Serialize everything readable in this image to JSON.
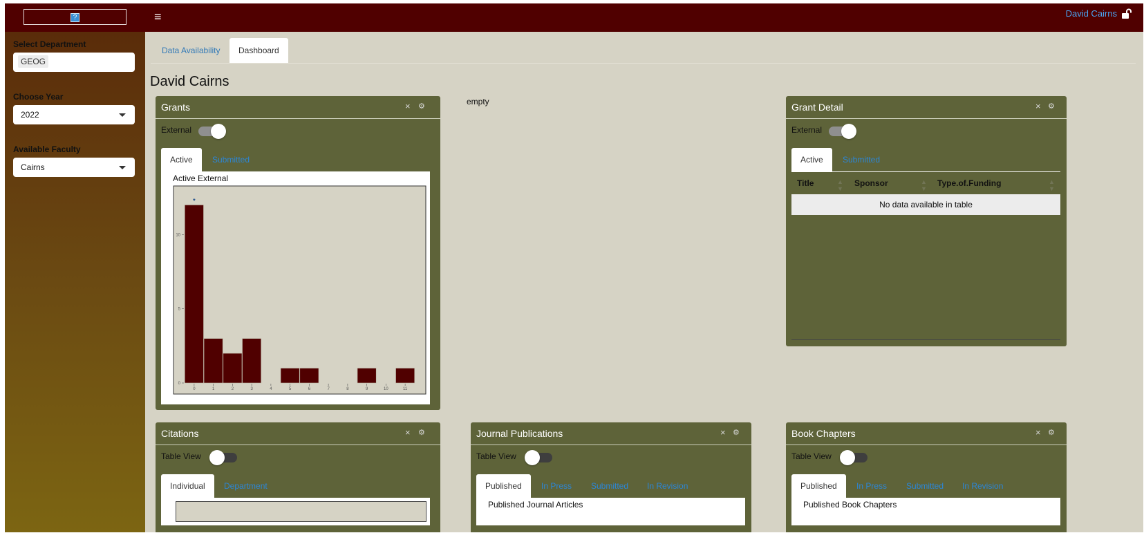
{
  "header": {
    "logo_icon": "?",
    "menu_icon": "≡",
    "user_name": "David Cairns",
    "lock_icon": "unlock-icon"
  },
  "sidebar": {
    "department_label": "Select Department",
    "department_value": "GEOG",
    "year_label": "Choose Year",
    "year_value": "2022",
    "faculty_label": "Available Faculty",
    "faculty_value": "Cairns"
  },
  "main_tabs": [
    {
      "label": "Data Availability",
      "active": false
    },
    {
      "label": "Dashboard",
      "active": true
    }
  ],
  "page_title": "David Cairns",
  "empty_text": "empty",
  "grants": {
    "title": "Grants",
    "toggle_label": "External",
    "toggle_on": true,
    "tabs": [
      "Active",
      "Submitted"
    ],
    "panel_caption": "Active External"
  },
  "grant_detail": {
    "title": "Grant Detail",
    "toggle_label": "External",
    "toggle_on": true,
    "tabs": [
      "Active",
      "Submitted"
    ],
    "columns": [
      "Title",
      "Sponsor",
      "Type.of.Funding"
    ],
    "no_data": "No data available in table"
  },
  "citations": {
    "title": "Citations",
    "toggle_label": "Table View",
    "toggle_on": false,
    "tabs": [
      "Individual",
      "Department"
    ],
    "panel_caption": ""
  },
  "journal_publications": {
    "title": "Journal Publications",
    "toggle_label": "Table View",
    "toggle_on": false,
    "tabs": [
      "Published",
      "In Press",
      "Submitted",
      "In Revision"
    ],
    "panel_caption": "Published Journal Articles"
  },
  "book_chapters": {
    "title": "Book Chapters",
    "toggle_label": "Table View",
    "toggle_on": false,
    "tabs": [
      "Published",
      "In Press",
      "Submitted",
      "In Revision"
    ],
    "panel_caption": "Published Book Chapters"
  },
  "box_controls": {
    "close": "×",
    "gear": "⚙"
  },
  "colors": {
    "header_bg": "#500000",
    "box_bg": "#5e6339",
    "bar_fill": "#500000",
    "link": "#2c86d6",
    "background": "#d6d3c5"
  },
  "chart_data": {
    "type": "bar",
    "title": "Active External",
    "xlabel": "",
    "ylabel": "",
    "categories": [
      "0",
      "1",
      "2",
      "3",
      "4",
      "5",
      "6",
      "7",
      "8",
      "9",
      "10",
      "11"
    ],
    "values": [
      12,
      3,
      2,
      3,
      0,
      1,
      1,
      0,
      0,
      1,
      0,
      1
    ],
    "ylim": [
      0,
      13
    ],
    "yticks": [
      "0",
      "5",
      "10"
    ],
    "grid": false,
    "marker_label": "*",
    "marker_category": "0"
  }
}
